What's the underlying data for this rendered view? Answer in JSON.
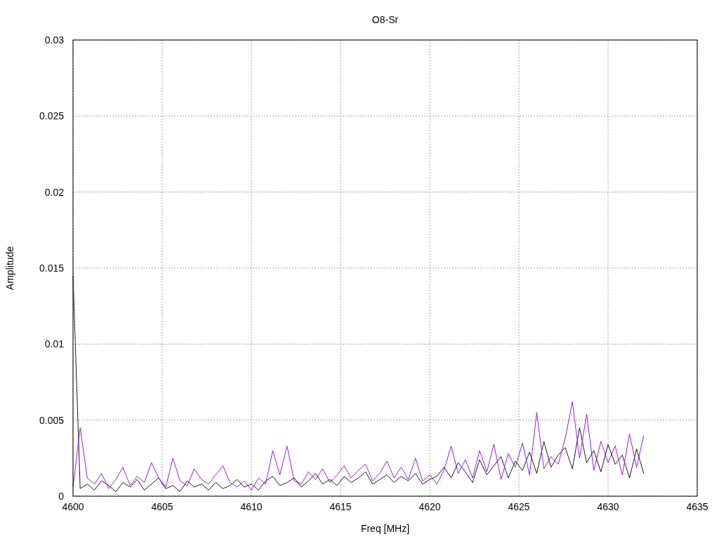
{
  "chart_data": {
    "type": "line",
    "title": "O8-Sr",
    "xlabel": "Freq [MHz]",
    "ylabel": "Amplitude",
    "xlim": [
      4600,
      4635
    ],
    "ylim": [
      0,
      0.03
    ],
    "grid": true,
    "xticks": [
      4600,
      4605,
      4610,
      4615,
      4620,
      4625,
      4630,
      4635
    ],
    "yticks": [
      0,
      0.005,
      0.01,
      0.015,
      0.02,
      0.025,
      0.03
    ],
    "x": [
      4600,
      4600.4,
      4600.8,
      4601.2,
      4601.6,
      4602,
      4602.4,
      4602.8,
      4603.2,
      4603.6,
      4604,
      4604.4,
      4604.8,
      4605.2,
      4605.6,
      4606,
      4606.4,
      4606.8,
      4607.2,
      4607.6,
      4608,
      4608.4,
      4608.8,
      4609.2,
      4609.6,
      4610,
      4610.4,
      4610.8,
      4611.2,
      4611.6,
      4612,
      4612.4,
      4612.8,
      4613.2,
      4613.6,
      4614,
      4614.4,
      4614.8,
      4615.2,
      4615.6,
      4616,
      4616.4,
      4616.8,
      4617.2,
      4617.6,
      4618,
      4618.4,
      4618.8,
      4619.2,
      4619.6,
      4620,
      4620.4,
      4620.8,
      4621.2,
      4621.6,
      4622,
      4622.4,
      4622.8,
      4623.2,
      4623.6,
      4624,
      4624.4,
      4624.8,
      4625.2,
      4625.6,
      4626,
      4626.4,
      4626.8,
      4627.2,
      4627.6,
      4628,
      4628.4,
      4628.8,
      4629.2,
      4629.6,
      4630,
      4630.4,
      4630.8,
      4631.2,
      4631.6,
      4632
    ],
    "series": [
      {
        "color": "#000000",
        "values": [
          0.0145,
          0.0005,
          0.0008,
          0.0004,
          0.001,
          0.0007,
          0.0003,
          0.0009,
          0.0006,
          0.0011,
          0.0004,
          0.0008,
          0.0012,
          0.0005,
          0.0007,
          0.0003,
          0.001,
          0.0006,
          0.0008,
          0.0004,
          0.0009,
          0.0005,
          0.0007,
          0.0011,
          0.0006,
          0.0008,
          0.0004,
          0.001,
          0.0013,
          0.0007,
          0.0009,
          0.0012,
          0.0006,
          0.001,
          0.0015,
          0.0008,
          0.0011,
          0.0007,
          0.0013,
          0.0009,
          0.0012,
          0.0016,
          0.0008,
          0.0011,
          0.0014,
          0.0009,
          0.0013,
          0.001,
          0.0015,
          0.0008,
          0.0011,
          0.0013,
          0.0019,
          0.0012,
          0.0022,
          0.0016,
          0.0009,
          0.0024,
          0.0014,
          0.002,
          0.0026,
          0.0012,
          0.0023,
          0.0017,
          0.0029,
          0.0015,
          0.0036,
          0.0019,
          0.0027,
          0.0032,
          0.0018,
          0.0045,
          0.0022,
          0.003,
          0.0016,
          0.0034,
          0.0021,
          0.0027,
          0.0012,
          0.0031,
          0.0015
        ]
      },
      {
        "color": "#9400d3",
        "values": [
          0.0006,
          0.0045,
          0.0012,
          0.0008,
          0.0015,
          0.0005,
          0.0011,
          0.0019,
          0.0007,
          0.0013,
          0.0009,
          0.0022,
          0.0012,
          0.0006,
          0.0025,
          0.001,
          0.0007,
          0.0018,
          0.0011,
          0.0008,
          0.0014,
          0.002,
          0.0009,
          0.0006,
          0.001,
          0.0004,
          0.0012,
          0.0008,
          0.003,
          0.0014,
          0.0033,
          0.001,
          0.0008,
          0.0016,
          0.0011,
          0.0018,
          0.0009,
          0.0014,
          0.002,
          0.0012,
          0.0017,
          0.0021,
          0.001,
          0.0015,
          0.0023,
          0.0012,
          0.0019,
          0.0011,
          0.0025,
          0.001,
          0.0014,
          0.0008,
          0.0017,
          0.0033,
          0.0015,
          0.0024,
          0.0012,
          0.003,
          0.0016,
          0.0034,
          0.0011,
          0.0028,
          0.0019,
          0.0035,
          0.0014,
          0.0055,
          0.0018,
          0.0026,
          0.0021,
          0.0038,
          0.0062,
          0.0025,
          0.0054,
          0.0017,
          0.0036,
          0.0022,
          0.0033,
          0.0014,
          0.0041,
          0.0019,
          0.004
        ]
      }
    ]
  }
}
